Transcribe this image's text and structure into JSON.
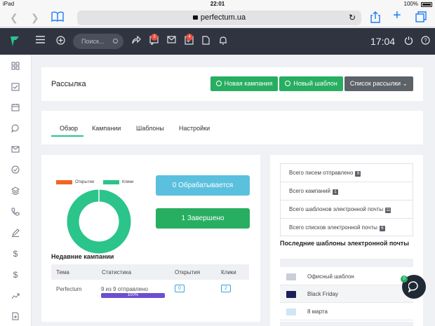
{
  "status_bar": {
    "device": "iPad",
    "time": "22:01",
    "battery": "100%"
  },
  "browser": {
    "url": "perfectum.ua"
  },
  "app_header": {
    "search_placeholder": "Поиск...",
    "chat_badge": "3",
    "tasks_badge": "4",
    "clock": "17:04"
  },
  "page": {
    "title": "Рассылка",
    "buttons": {
      "new_campaign": "Новая кампания",
      "new_template": "Новый шаблон",
      "mailing_list": "Список рассылки"
    }
  },
  "tabs": [
    "Обзор",
    "Кампании",
    "Шаблоны",
    "Настройки"
  ],
  "chart_data": {
    "type": "pie",
    "legend": [
      "Открытия",
      "Клики"
    ],
    "colors": {
      "opens": "#f26522",
      "clicks": "#2bc48a"
    },
    "values": [
      0,
      100
    ]
  },
  "stats": {
    "processing": "0 Обрабатывается",
    "completed": "1 Завершено"
  },
  "recent": {
    "title": "Недавние кампании",
    "headers": [
      "Тема",
      "Статистика",
      "Открытия",
      "Клики"
    ],
    "rows": [
      {
        "subject": "Perfectum",
        "stat": "9 из 9 отправлено",
        "progress_label": "100%",
        "progress": 1.0,
        "opens": "0",
        "clicks": "2"
      }
    ]
  },
  "summary": [
    {
      "label": "Всего писем отправлено",
      "count": "9"
    },
    {
      "label": "Всего кампаний",
      "count": "1"
    },
    {
      "label": "Всего шаблонов электронной почты",
      "count": "11"
    },
    {
      "label": "Всего списков электронной почты",
      "count": "6"
    }
  ],
  "templates": {
    "title": "Последние шаблоны электронной почты",
    "items": [
      "Офисный шаблон",
      "Black Friday",
      "8 марта"
    ]
  },
  "chat_badge": "0",
  "colors": {
    "green": "#27ae60",
    "teal": "#2bc48a",
    "cyan": "#5bc0de",
    "dark": "#2f3440"
  }
}
